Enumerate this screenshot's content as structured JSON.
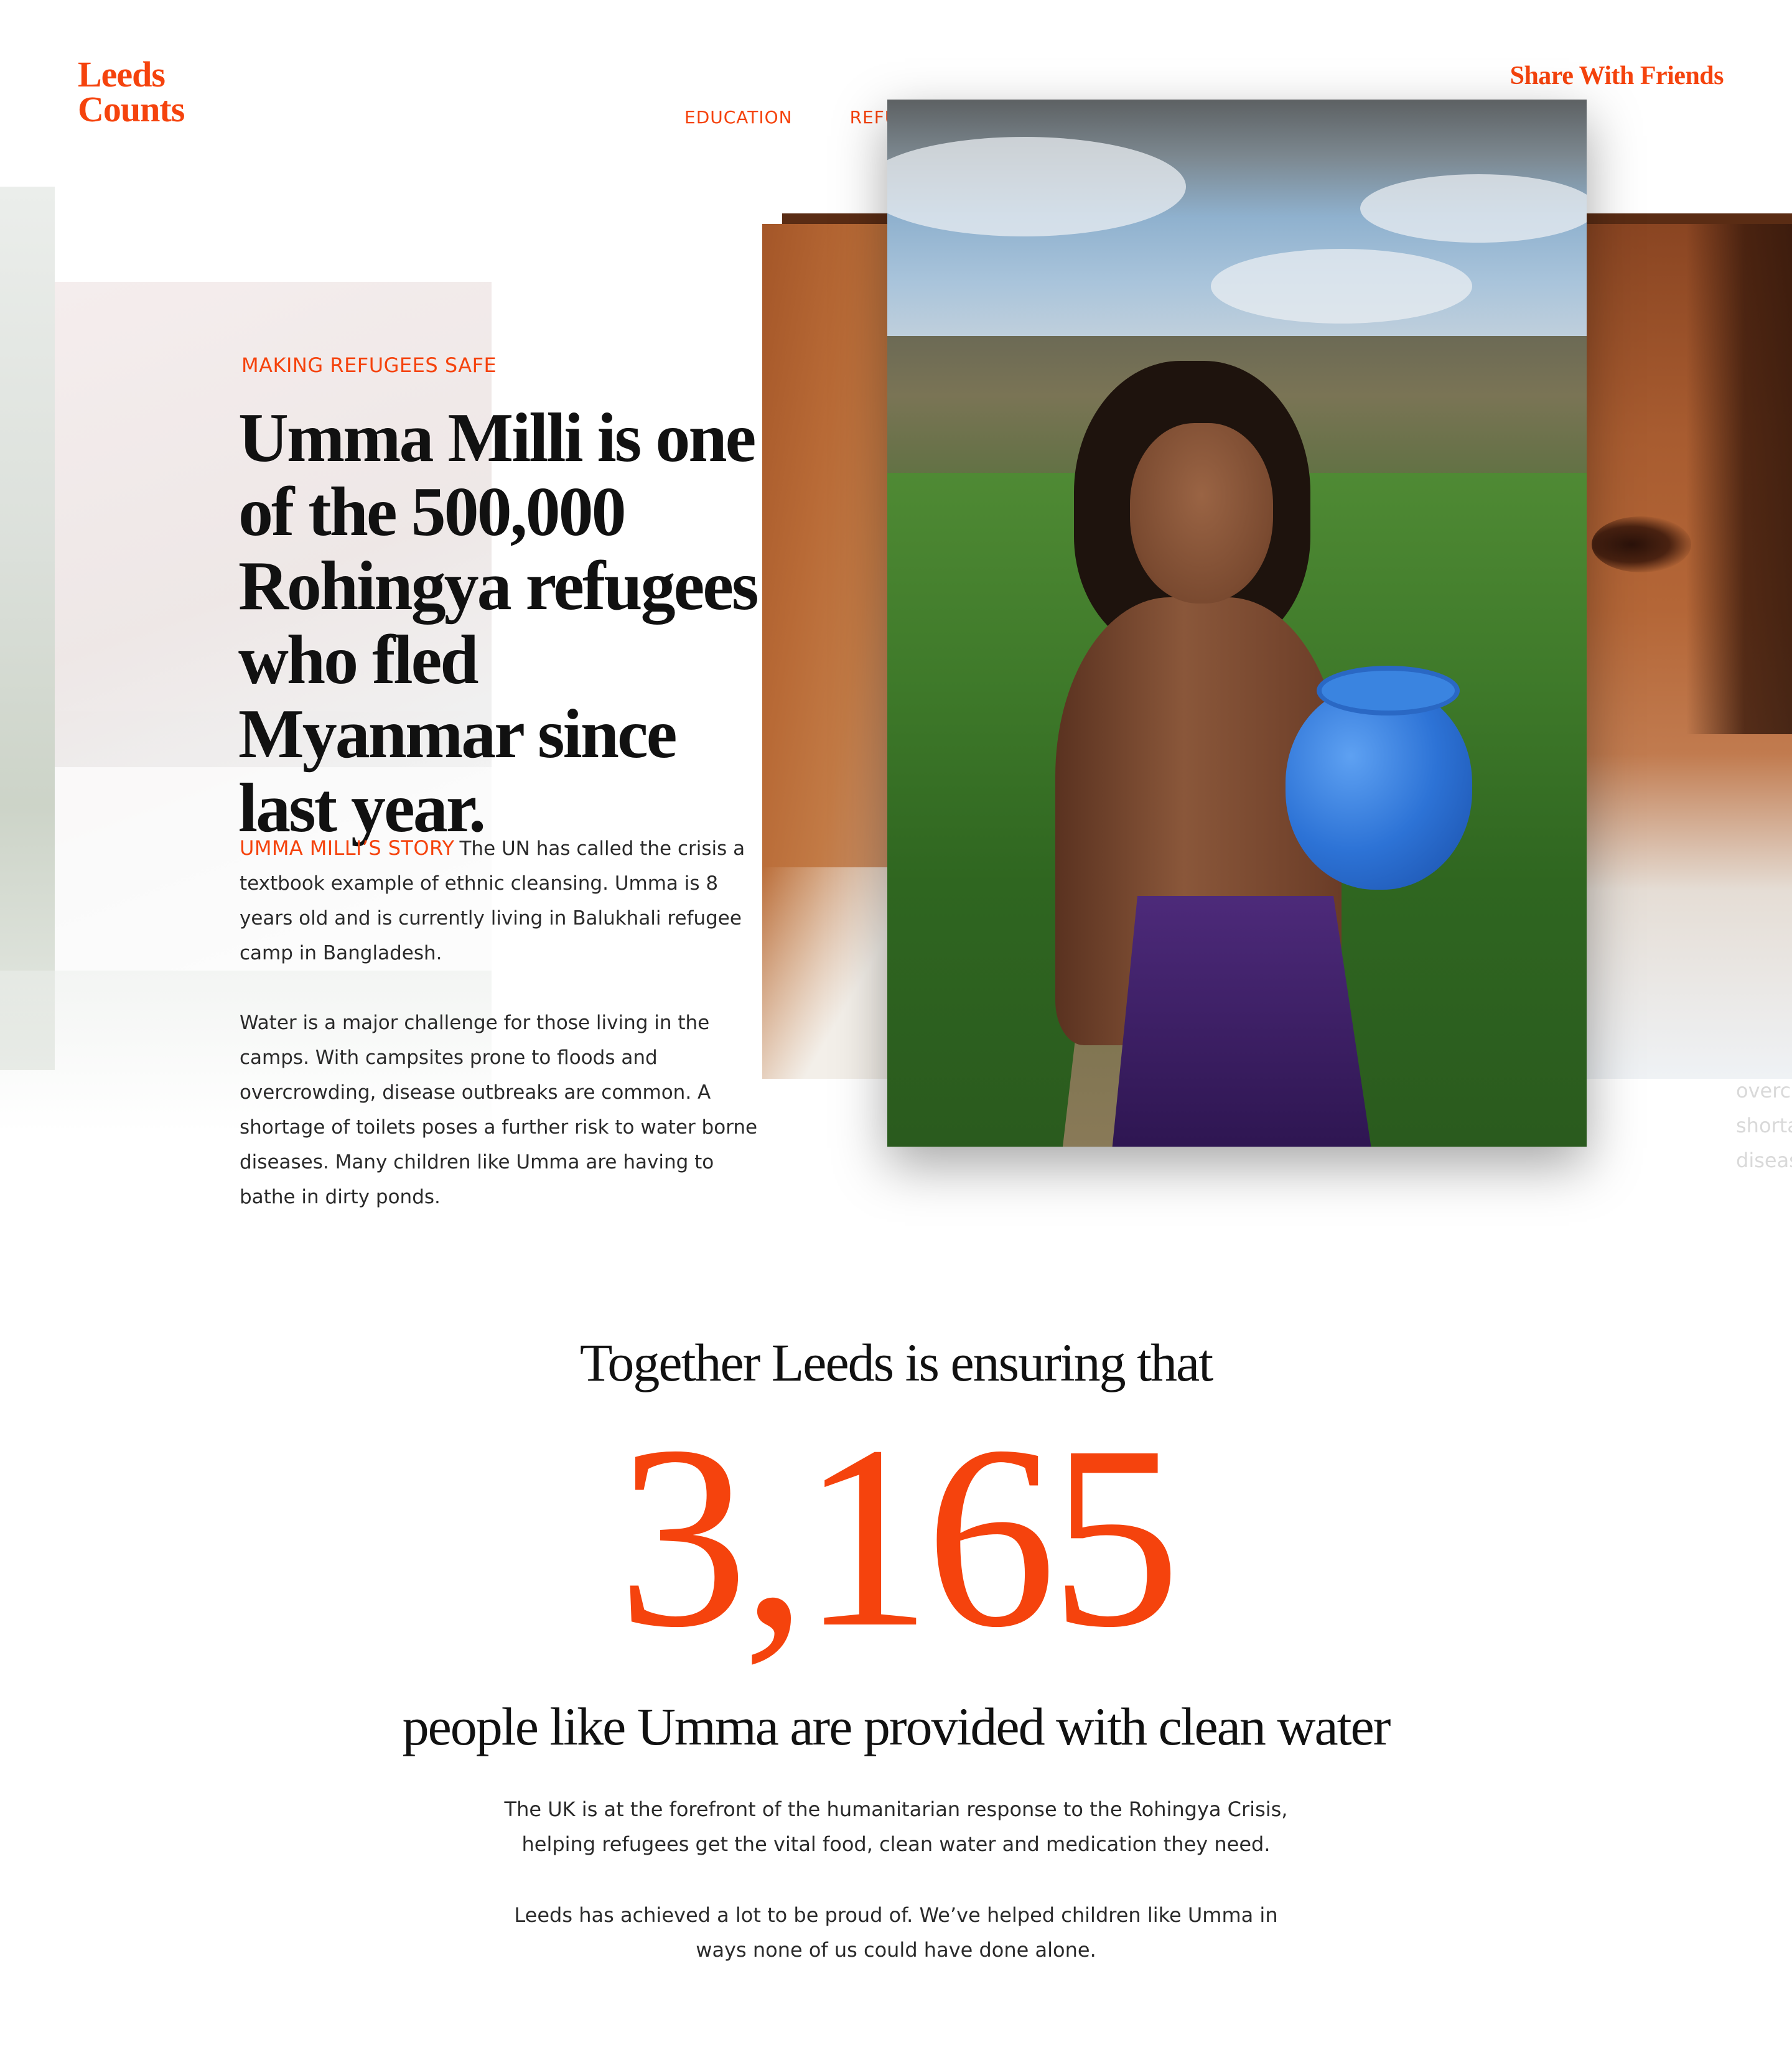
{
  "brand": {
    "logo_line1": "Leeds",
    "logo_line2": "Counts",
    "share_label": "Share With Friends"
  },
  "nav": {
    "items": [
      "EDUCATION",
      "REFU"
    ]
  },
  "story": {
    "kicker": "MAKING REFUGEES SAFE",
    "headline": "Umma Milli is one of the 500,000 Rohingya refugees who fled Myanmar since last year.",
    "tag": "UMMA MILLI’S STORY",
    "paragraph1": "The UN has called the crisis a textbook example of ethnic cleansing. Umma is 8 years old and is currently living in Balukhali refugee camp in Bangladesh.",
    "paragraph2": "Water is a major challenge for those living in the camps. With campsites prone to floods and overcrowding, disease outbreaks are common. A shortage of toilets poses a further risk to water borne diseases. Many children like Umma are having to bathe in dirty ponds."
  },
  "overflow": {
    "line1": "overcr",
    "line2": "shorta",
    "line3": "diseas"
  },
  "impact": {
    "intro": "Together Leeds is ensuring that",
    "count": "3,165",
    "outcome": "people like Umma are provided with clean water",
    "para1_line1": "The UK is at the forefront of the humanitarian response to the Rohingya Crisis,",
    "para1_line2": "helping refugees get the vital food, clean water and medication they need.",
    "para2_line1": "Leeds has achieved a lot to be proud of. We’ve helped children like Umma in",
    "para2_line2": "ways none of us could have done alone."
  },
  "colors": {
    "accent": "#f5430d",
    "text": "#1a1a1a"
  }
}
